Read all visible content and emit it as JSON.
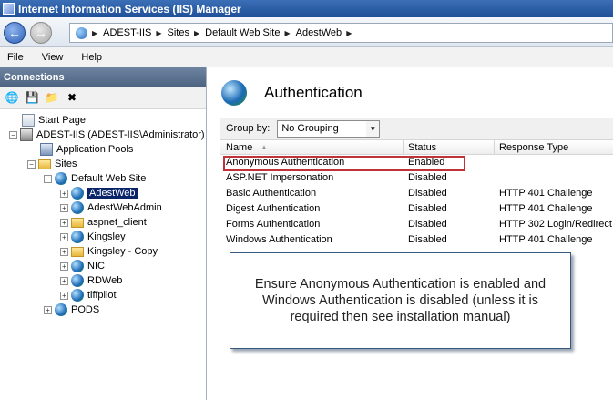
{
  "window": {
    "title": "Internet Information Services (IIS) Manager"
  },
  "breadcrumbs": [
    "ADEST-IIS",
    "Sites",
    "Default Web Site",
    "AdestWeb"
  ],
  "menu": [
    "File",
    "View",
    "Help"
  ],
  "connections": {
    "header": "Connections",
    "tree": [
      {
        "label": "Start Page",
        "icon": "start-page-icon"
      },
      {
        "label": "ADEST-IIS (ADEST-IIS\\Administrator)",
        "icon": "server-icon"
      },
      {
        "label": "Application Pools",
        "icon": "app-pool-icon"
      },
      {
        "label": "Sites",
        "icon": "folder-icon"
      },
      {
        "label": "Default Web Site",
        "icon": "globe-icon"
      },
      {
        "label": "AdestWeb",
        "icon": "globe-icon",
        "selected": true
      },
      {
        "label": "AdestWebAdmin",
        "icon": "globe-icon"
      },
      {
        "label": "aspnet_client",
        "icon": "folder-icon"
      },
      {
        "label": "Kingsley",
        "icon": "globe-icon"
      },
      {
        "label": "Kingsley - Copy",
        "icon": "folder-icon"
      },
      {
        "label": "NIC",
        "icon": "globe-icon"
      },
      {
        "label": "RDWeb",
        "icon": "globe-icon"
      },
      {
        "label": "tiffpilot",
        "icon": "globe-icon"
      },
      {
        "label": "PODS",
        "icon": "globe-icon"
      }
    ]
  },
  "main": {
    "title": "Authentication",
    "group_by_label": "Group by:",
    "group_by_value": "No Grouping",
    "columns": [
      "Name",
      "Status",
      "Response Type"
    ],
    "rows": [
      {
        "name": "Anonymous Authentication",
        "status": "Enabled",
        "response": ""
      },
      {
        "name": "ASP.NET Impersonation",
        "status": "Disabled",
        "response": ""
      },
      {
        "name": "Basic Authentication",
        "status": "Disabled",
        "response": "HTTP 401 Challenge"
      },
      {
        "name": "Digest Authentication",
        "status": "Disabled",
        "response": "HTTP 401 Challenge"
      },
      {
        "name": "Forms Authentication",
        "status": "Disabled",
        "response": "HTTP 302 Login/Redirect"
      },
      {
        "name": "Windows Authentication",
        "status": "Disabled",
        "response": "HTTP 401 Challenge"
      }
    ]
  },
  "callout": {
    "text": "Ensure Anonymous Authentication is enabled and Windows Authentication  is disabled (unless it is required then see installation manual)"
  },
  "colors": {
    "highlight": "#c0323a",
    "selection": "#0a246a",
    "titlebar": "#1f4f98"
  }
}
